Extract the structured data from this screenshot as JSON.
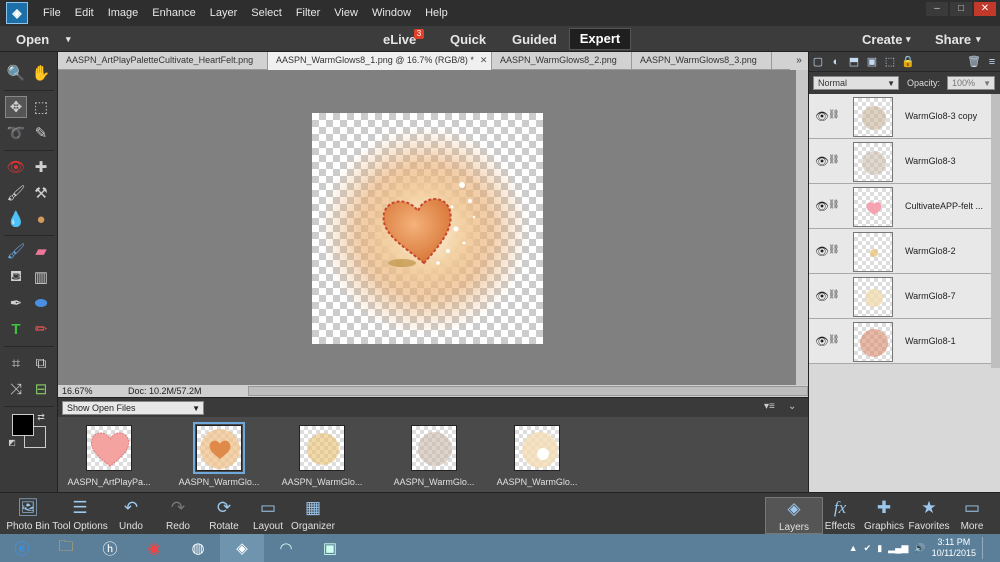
{
  "menu": [
    "File",
    "Edit",
    "Image",
    "Enhance",
    "Layer",
    "Select",
    "Filter",
    "View",
    "Window",
    "Help"
  ],
  "window_buttons": [
    "–",
    "□",
    "✕"
  ],
  "modebar": {
    "open": "Open",
    "elive": "eLive",
    "elive_badge": "3",
    "quick": "Quick",
    "guided": "Guided",
    "expert": "Expert",
    "create": "Create",
    "share": "Share"
  },
  "tabs": [
    {
      "label": "AASPN_ArtPlayPaletteCultivate_HeartFelt.png",
      "close": "✕"
    },
    {
      "label": "AASPN_WarmGlows8_1.png @ 16.7% (RGB/8) *",
      "close": "✕"
    },
    {
      "label": "AASPN_WarmGlows8_2.png",
      "close": "✕"
    },
    {
      "label": "AASPN_WarmGlows8_3.png",
      "close": "✕"
    }
  ],
  "tab_more": "»",
  "status": {
    "zoom": "16.67%",
    "doc": "Doc: 10.2M/57.2M"
  },
  "bin": {
    "selector": "Show Open Files"
  },
  "thumbs": [
    {
      "label": "AASPN_ArtPlayPa..."
    },
    {
      "label": "AASPN_WarmGlo..."
    },
    {
      "label": "AASPN_WarmGlo..."
    },
    {
      "label": "AASPN_WarmGlo..."
    },
    {
      "label": "AASPN_WarmGlo..."
    }
  ],
  "layers_panel": {
    "blend_mode": "Normal",
    "opacity_label": "Opacity:",
    "opacity_value": "100%"
  },
  "layers": [
    {
      "name": "WarmGlo8-3 copy"
    },
    {
      "name": "WarmGlo8-3"
    },
    {
      "name": "CultivateAPP-felt ..."
    },
    {
      "name": "WarmGlo8-2"
    },
    {
      "name": "WarmGlo8-7"
    },
    {
      "name": "WarmGlo8-1"
    }
  ],
  "bottom_left": [
    "Photo Bin",
    "Tool Options",
    "Undo",
    "Redo",
    "Rotate",
    "Layout",
    "Organizer"
  ],
  "bottom_right": [
    "Layers",
    "Effects",
    "Graphics",
    "Favorites",
    "More"
  ],
  "clock": {
    "time": "3:11 PM",
    "date": "10/11/2015"
  },
  "colors": {
    "accent": "#1f6fb0",
    "heart": "#e07a4f",
    "glow": "#f2c890"
  }
}
